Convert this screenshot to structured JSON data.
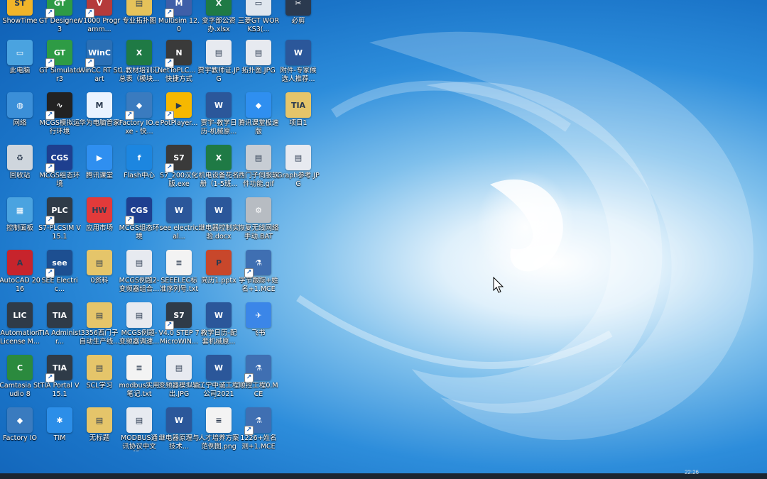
{
  "desktop": {
    "icons": [
      {
        "label": "ShowTime",
        "short": "ST",
        "color": "#f0b429",
        "shortcut": false
      },
      {
        "label": "GT Designer3",
        "short": "GT",
        "color": "#2e9b45",
        "shortcut": true
      },
      {
        "label": "V1000 Programm...",
        "short": "V",
        "color": "#b53b3b",
        "shortcut": true
      },
      {
        "label": "专业拓扑图",
        "short": "▤",
        "color": "#e6c25a",
        "shortcut": false
      },
      {
        "label": "Multisim 12.0",
        "short": "M",
        "color": "#3f5fa8",
        "shortcut": true
      },
      {
        "label": "变字部公资办.xlsx",
        "short": "X",
        "color": "#1f7a45",
        "shortcut": false
      },
      {
        "label": "三菱GT WORKS3(...",
        "short": "▭",
        "color": "#dfe6ee",
        "shortcut": false
      },
      {
        "label": "必剪",
        "short": "✂",
        "color": "#2b3a4f",
        "shortcut": false
      },
      {
        "label": "此电脑",
        "short": "▭",
        "color": "#4aa3e0",
        "shortcut": false
      },
      {
        "label": "GT Simulator3",
        "short": "GT",
        "color": "#2e9b45",
        "shortcut": true
      },
      {
        "label": "WinCC RT Start",
        "short": "WinC",
        "color": "#2a6fb5",
        "shortcut": true
      },
      {
        "label": "1.教材培训汇总表（模块...",
        "short": "X",
        "color": "#1f7a45",
        "shortcut": false
      },
      {
        "label": "NetToPLC... - 快捷方式",
        "short": "N",
        "color": "#3a3a3a",
        "shortcut": true
      },
      {
        "label": "贾宇教师证.JPG",
        "short": "▤",
        "color": "#e7eaf0",
        "shortcut": false
      },
      {
        "label": "拓扑图.JPG",
        "short": "▤",
        "color": "#e7eaf0",
        "shortcut": false
      },
      {
        "label": "附件-专家候选人推荐...",
        "short": "W",
        "color": "#2b579a",
        "shortcut": false
      },
      {
        "label": "网络",
        "short": "◍",
        "color": "#3b8fd8",
        "shortcut": false
      },
      {
        "label": "MCGS模拟运行环境",
        "short": "∿",
        "color": "#222",
        "shortcut": true
      },
      {
        "label": "华为电脑管家",
        "short": "M",
        "color": "#eaf3ff",
        "shortcut": false
      },
      {
        "label": "Factory IO.exe - 快...",
        "short": "◆",
        "color": "#3a7bbf",
        "shortcut": true
      },
      {
        "label": "PotPlayer...",
        "short": "▶",
        "color": "#f6b800",
        "shortcut": true
      },
      {
        "label": "贾宇-教学日历-机械原...",
        "short": "W",
        "color": "#2b579a",
        "shortcut": false
      },
      {
        "label": "腾讯课堂极速版",
        "short": "◆",
        "color": "#2f8ff0",
        "shortcut": false
      },
      {
        "label": "项目1",
        "short": "TIA",
        "color": "#e5c56a",
        "shortcut": false
      },
      {
        "label": "回收站",
        "short": "♻",
        "color": "#cfd6dd",
        "shortcut": false
      },
      {
        "label": "MCGS组态环境",
        "short": "CGS",
        "color": "#1e3f8f",
        "shortcut": true
      },
      {
        "label": "腾讯课堂",
        "short": "▶",
        "color": "#2f8ff0",
        "shortcut": false
      },
      {
        "label": "Flash中心",
        "short": "f",
        "color": "#1c86e0",
        "shortcut": false
      },
      {
        "label": "S7_200汉化版.exe",
        "short": "S7",
        "color": "#3a3a3a",
        "shortcut": true
      },
      {
        "label": "机电设备花名册（1-5班...",
        "short": "X",
        "color": "#1f7a45",
        "shortcut": false
      },
      {
        "label": "西门子伺服软件功能.gif",
        "short": "▤",
        "color": "#c7cdd4",
        "shortcut": false
      },
      {
        "label": "Graph参考.JPG",
        "short": "▤",
        "color": "#e7eaf0",
        "shortcut": false
      },
      {
        "label": "控制面板",
        "short": "▦",
        "color": "#4aa3e0",
        "shortcut": false
      },
      {
        "label": "S7-PLCSIM V15.1",
        "short": "PLC",
        "color": "#2f3b48",
        "shortcut": true
      },
      {
        "label": "应用市场",
        "short": "HW",
        "color": "#e23a3a",
        "shortcut": false
      },
      {
        "label": "MCGS组态环境",
        "short": "CGS",
        "color": "#1e3f8f",
        "shortcut": true
      },
      {
        "label": "see electrical...",
        "short": "W",
        "color": "#2b579a",
        "shortcut": false
      },
      {
        "label": "继电器控制实验.docx",
        "short": "W",
        "color": "#2b579a",
        "shortcut": false
      },
      {
        "label": "恢复无线网络手动.BAT",
        "short": "⚙",
        "color": "#b7bcc2",
        "shortcut": false
      },
      {
        "label": "AutoCAD 2016",
        "short": "A",
        "color": "#c7242c",
        "shortcut": false
      },
      {
        "label": "SEE Electric...",
        "short": "see",
        "color": "#1d4f91",
        "shortcut": true
      },
      {
        "label": "0资料",
        "short": "▤",
        "color": "#e5c56a",
        "shortcut": false
      },
      {
        "label": "MCGS例题2-变频器组合...",
        "short": "▤",
        "color": "#e7eaf0",
        "shortcut": false
      },
      {
        "label": "SEEELEC标准序列号.txt",
        "short": "≡",
        "color": "#f3f3f3",
        "shortcut": false
      },
      {
        "label": "简历1.pptx",
        "short": "P",
        "color": "#c8472b",
        "shortcut": false
      },
      {
        "label": "字节跟踪+姓名+1.MCE",
        "short": "⚗",
        "color": "#3f6fb2",
        "shortcut": true
      },
      {
        "label": "Automation License M...",
        "short": "LIC",
        "color": "#2f3b48",
        "shortcut": false
      },
      {
        "label": "TIA Administr...",
        "short": "TIA",
        "color": "#2f3b48",
        "shortcut": false
      },
      {
        "label": "3356西门子自动生产线...",
        "short": "▤",
        "color": "#e5c56a",
        "shortcut": false
      },
      {
        "label": "MCGS例题-变频器调速...",
        "short": "▤",
        "color": "#e7eaf0",
        "shortcut": false
      },
      {
        "label": "V4.0 STEP 7 MicroWIN...",
        "short": "S7",
        "color": "#2f3b48",
        "shortcut": true
      },
      {
        "label": "教学日历-配套机械原...",
        "short": "W",
        "color": "#2b579a",
        "shortcut": false
      },
      {
        "label": "飞书",
        "short": "✈",
        "color": "#3b86e8",
        "shortcut": false
      },
      {
        "label": "Camtasia Studio 8",
        "short": "C",
        "color": "#2b8a3e",
        "shortcut": false
      },
      {
        "label": "TIA Portal V15.1",
        "short": "TIA",
        "color": "#2f3b48",
        "shortcut": true
      },
      {
        "label": "SCL学习",
        "short": "▤",
        "color": "#e5c56a",
        "shortcut": false
      },
      {
        "label": "modbus实用笔记.txt",
        "short": "≡",
        "color": "#f3f3f3",
        "shortcut": false
      },
      {
        "label": "变频器模拟输出.JPG",
        "short": "▤",
        "color": "#e7eaf0",
        "shortcut": false
      },
      {
        "label": "辽宁中诚工程公司2021年...",
        "short": "W",
        "color": "#2b579a",
        "shortcut": false
      },
      {
        "label": "顺控工程0.MCE",
        "short": "⚗",
        "color": "#3f6fb2",
        "shortcut": true
      },
      {
        "label": "Factory IO",
        "short": "◆",
        "color": "#3a7bbf",
        "shortcut": false
      },
      {
        "label": "TIM",
        "short": "✱",
        "color": "#2c8ee8",
        "shortcut": false
      },
      {
        "label": "无标题",
        "short": "▤",
        "color": "#e5c56a",
        "shortcut": false
      },
      {
        "label": "MODBUS通讯协议中文版...",
        "short": "▤",
        "color": "#e7eaf0",
        "shortcut": false
      },
      {
        "label": "继电器原理与技术...",
        "short": "W",
        "color": "#2b579a",
        "shortcut": false
      },
      {
        "label": "人才培养方案范例图.png",
        "short": "≡",
        "color": "#f3f3f3",
        "shortcut": false
      },
      {
        "label": "1226+姓名测+1.MCE",
        "short": "⚗",
        "color": "#3f6fb2",
        "shortcut": true
      }
    ]
  },
  "taskbar": {
    "clock": "22:26"
  }
}
